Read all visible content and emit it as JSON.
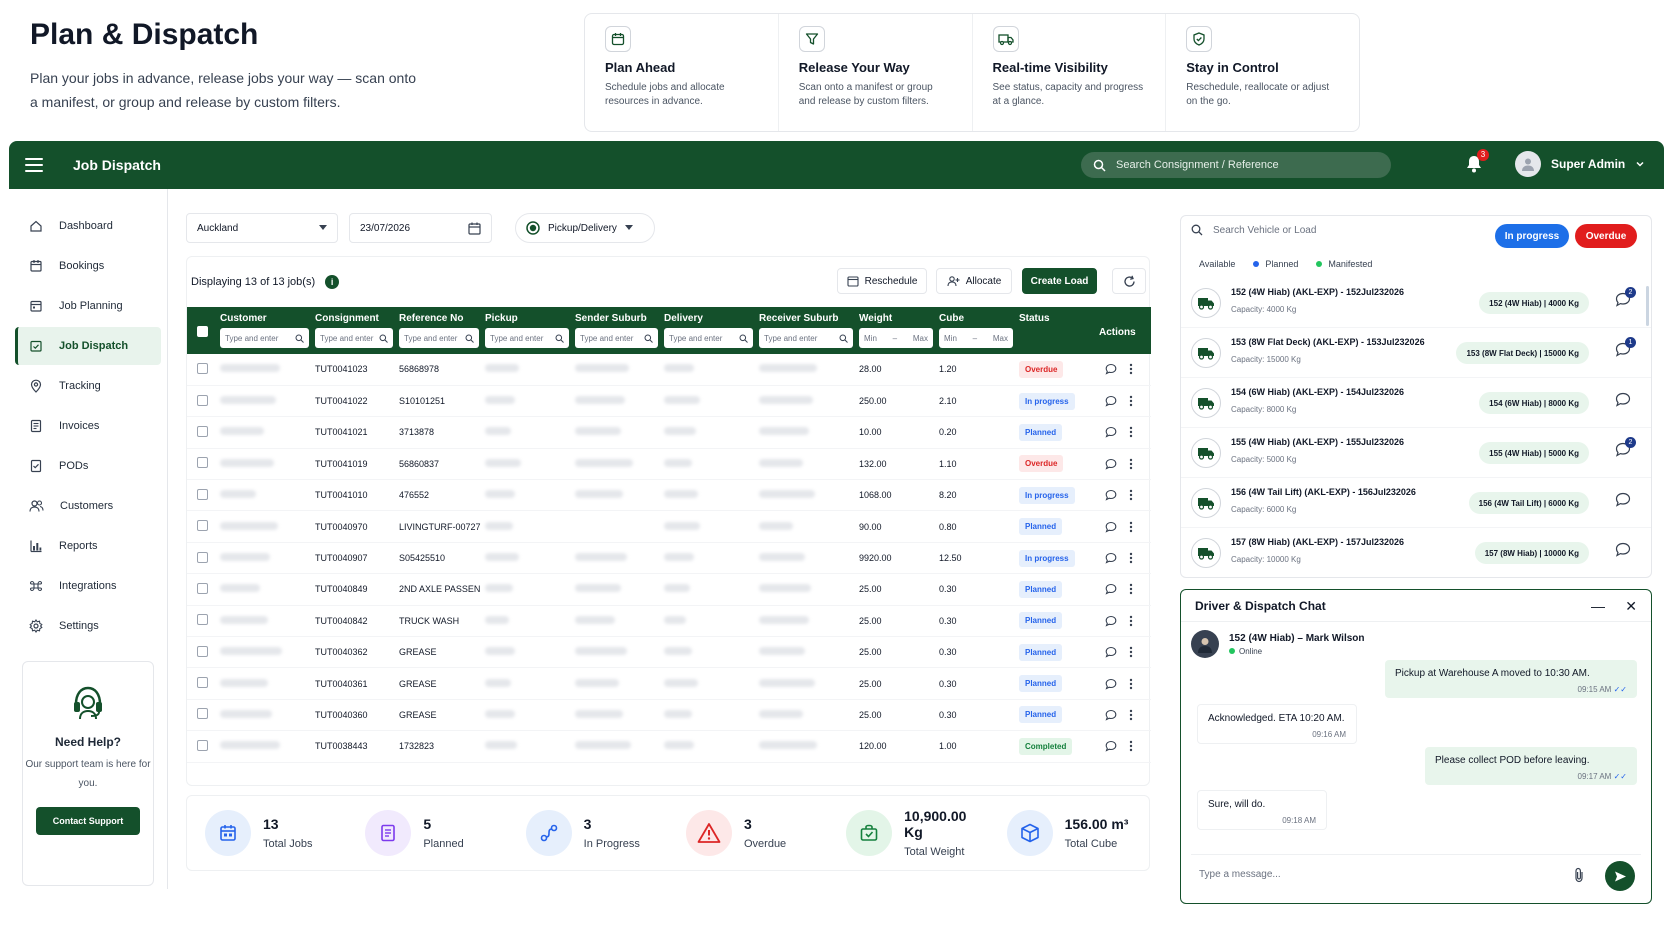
{
  "hero": {
    "title": "Plan & Dispatch",
    "subtitle": "Plan your jobs in advance, release jobs your way — scan onto a manifest, or group and release by custom filters."
  },
  "features": [
    {
      "title": "Plan Ahead",
      "desc": "Schedule jobs and allocate resources in advance.",
      "icon": "calendar-icon"
    },
    {
      "title": "Release Your Way",
      "desc": "Scan onto a manifest or group and release by custom filters.",
      "icon": "filter-icon"
    },
    {
      "title": "Real-time Visibility",
      "desc": "See status, capacity and progress at a glance.",
      "icon": "truck-icon"
    },
    {
      "title": "Stay in Control",
      "desc": "Reschedule, reallocate or adjust on the go.",
      "icon": "shield-icon"
    }
  ],
  "topbar": {
    "title": "Job Dispatch",
    "search_placeholder": "Search Consignment / Reference",
    "notifications": "3",
    "user": "Super Admin"
  },
  "sidebar": {
    "items": [
      {
        "label": "Dashboard",
        "icon": "home-icon"
      },
      {
        "label": "Bookings",
        "icon": "bookings-icon"
      },
      {
        "label": "Job Planning",
        "icon": "calendar-icon"
      },
      {
        "label": "Job Dispatch",
        "icon": "dispatch-icon"
      },
      {
        "label": "Tracking",
        "icon": "location-icon"
      },
      {
        "label": "Invoices",
        "icon": "invoice-icon"
      },
      {
        "label": "PODs",
        "icon": "pod-icon"
      },
      {
        "label": "Customers",
        "icon": "customers-icon"
      },
      {
        "label": "Reports",
        "icon": "reports-icon"
      },
      {
        "label": "Integrations",
        "icon": "integrations-icon"
      },
      {
        "label": "Settings",
        "icon": "gear-icon"
      }
    ],
    "help": {
      "title": "Need Help?",
      "text": "Our support team is here for you.",
      "button": "Contact Support"
    }
  },
  "filters": {
    "region": "Auckland",
    "date": "23/07/2026",
    "mode": "Pickup/Delivery"
  },
  "table": {
    "display_text": "Displaying 13 of 13 job(s)",
    "buttons": {
      "reschedule": "Reschedule",
      "allocate": "Allocate",
      "create_load": "Create Load"
    },
    "columns": [
      "Customer",
      "Consignment",
      "Reference No",
      "Pickup",
      "Sender Suburb",
      "Delivery",
      "Receiver Suburb",
      "Weight",
      "Cube",
      "Status",
      "Actions"
    ],
    "filter_placeholder": "Type and enter",
    "min": "Min",
    "max": "Max",
    "rows": [
      {
        "consignment": "TUT0041023",
        "reference": "56868978",
        "weight": "28.00",
        "cube": "1.20",
        "status": "Overdue"
      },
      {
        "consignment": "TUT0041022",
        "reference": "S10101251",
        "weight": "250.00",
        "cube": "2.10",
        "status": "In progress"
      },
      {
        "consignment": "TUT0041021",
        "reference": "3713878",
        "weight": "10.00",
        "cube": "0.20",
        "status": "Planned"
      },
      {
        "consignment": "TUT0041019",
        "reference": "56860837",
        "weight": "132.00",
        "cube": "1.10",
        "status": "Overdue"
      },
      {
        "consignment": "TUT0041010",
        "reference": "476552",
        "weight": "1068.00",
        "cube": "8.20",
        "status": "In progress"
      },
      {
        "consignment": "TUT0040970",
        "reference": "LIVINGTURF-00727",
        "weight": "90.00",
        "cube": "0.80",
        "status": "Planned"
      },
      {
        "consignment": "TUT0040907",
        "reference": "S05425510",
        "weight": "9920.00",
        "cube": "12.50",
        "status": "In progress"
      },
      {
        "consignment": "TUT0040849",
        "reference": "2ND AXLE PASSEN",
        "weight": "25.00",
        "cube": "0.30",
        "status": "Planned"
      },
      {
        "consignment": "TUT0040842",
        "reference": "TRUCK WASH",
        "weight": "25.00",
        "cube": "0.30",
        "status": "Planned"
      },
      {
        "consignment": "TUT0040362",
        "reference": "GREASE",
        "weight": "25.00",
        "cube": "0.30",
        "status": "Planned"
      },
      {
        "consignment": "TUT0040361",
        "reference": "GREASE",
        "weight": "25.00",
        "cube": "0.30",
        "status": "Planned"
      },
      {
        "consignment": "TUT0040360",
        "reference": "GREASE",
        "weight": "25.00",
        "cube": "0.30",
        "status": "Planned"
      },
      {
        "consignment": "TUT0038443",
        "reference": "1732823",
        "weight": "120.00",
        "cube": "1.00",
        "status": "Completed"
      }
    ]
  },
  "summary": [
    {
      "value": "13",
      "label": "Total Jobs",
      "icon": "jobs-icon",
      "color": "#2563eb",
      "bg": "#e6effc"
    },
    {
      "value": "5",
      "label": "Planned",
      "icon": "planned-icon",
      "color": "#7c3aed",
      "bg": "#f1eafd"
    },
    {
      "value": "3",
      "label": "In Progress",
      "icon": "progress-icon",
      "color": "#2563eb",
      "bg": "#e6effc"
    },
    {
      "value": "3",
      "label": "Overdue",
      "icon": "warning-icon",
      "color": "#dc2626",
      "bg": "#fde8e8"
    },
    {
      "value": "10,900.00 Kg",
      "label": "Total Weight",
      "icon": "weight-icon",
      "color": "#15803d",
      "bg": "#e3f5e8"
    },
    {
      "value": "156.00 m³",
      "label": "Total Cube",
      "icon": "cube-icon",
      "color": "#2563eb",
      "bg": "#e6effc"
    }
  ],
  "vehicles": {
    "search_placeholder": "Search Vehicle or Load",
    "pill_progress": "In progress",
    "pill_overdue": "Overdue",
    "legend": [
      "Available",
      "Planned",
      "Manifested"
    ],
    "items": [
      {
        "name": "152 (4W Hiab) (AKL-EXP) - 152Jul232026",
        "capacity": "Capacity: 4000 Kg",
        "tag": "152 (4W Hiab) | 4000 Kg",
        "badge": "2"
      },
      {
        "name": "153 (8W Flat Deck) (AKL-EXP) - 153Jul232026",
        "capacity": "Capacity: 15000 Kg",
        "tag": "153 (8W Flat Deck) | 15000 Kg",
        "badge": "1"
      },
      {
        "name": "154 (6W Hiab) (AKL-EXP) - 154Jul232026",
        "capacity": "Capacity: 8000 Kg",
        "tag": "154 (6W Hiab) | 8000 Kg",
        "badge": ""
      },
      {
        "name": "155 (4W Hiab) (AKL-EXP) - 155Jul232026",
        "capacity": "Capacity: 5000 Kg",
        "tag": "155 (4W Hiab) | 5000 Kg",
        "badge": "2"
      },
      {
        "name": "156 (4W Tail Lift) (AKL-EXP) - 156Jul232026",
        "capacity": "Capacity: 6000 Kg",
        "tag": "156 (4W Tail Lift) | 6000 Kg",
        "badge": ""
      },
      {
        "name": "157 (8W Hiab) (AKL-EXP) - 157Jul232026",
        "capacity": "Capacity: 10000 Kg",
        "tag": "157 (8W Hiab) | 10000 Kg",
        "badge": ""
      }
    ]
  },
  "chat": {
    "title": "Driver & Dispatch Chat",
    "contact": "152 (4W Hiab) – Mark Wilson",
    "status": "Online",
    "messages": [
      {
        "text": "Pickup at Warehouse A moved to 10:30 AM.",
        "time": "09:15 AM",
        "dir": "out"
      },
      {
        "text": "Acknowledged. ETA 10:20 AM.",
        "time": "09:16 AM",
        "dir": "in"
      },
      {
        "text": "Please collect POD before leaving.",
        "time": "09:17 AM",
        "dir": "out"
      },
      {
        "text": "Sure, will do.",
        "time": "09:18 AM",
        "dir": "in"
      }
    ],
    "input_placeholder": "Type a message..."
  }
}
